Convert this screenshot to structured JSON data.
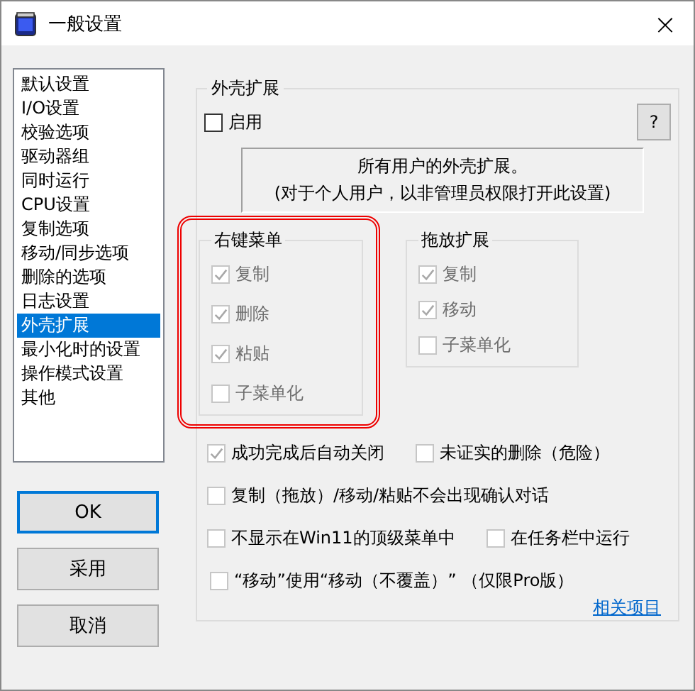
{
  "window": {
    "title": "一般设置",
    "close": "×"
  },
  "sidebar": {
    "items": [
      {
        "label": "默认设置",
        "selected": false
      },
      {
        "label": "I/O设置",
        "selected": false
      },
      {
        "label": "校验选项",
        "selected": false
      },
      {
        "label": "驱动器组",
        "selected": false
      },
      {
        "label": "同时运行",
        "selected": false
      },
      {
        "label": "CPU设置",
        "selected": false
      },
      {
        "label": "复制选项",
        "selected": false
      },
      {
        "label": "移动/同步选项",
        "selected": false
      },
      {
        "label": "删除的选项",
        "selected": false
      },
      {
        "label": "日志设置",
        "selected": false
      },
      {
        "label": "外壳扩展",
        "selected": true
      },
      {
        "label": "最小化时的设置",
        "selected": false
      },
      {
        "label": "操作模式设置",
        "selected": false
      },
      {
        "label": "其他",
        "selected": false
      }
    ]
  },
  "buttons": [
    {
      "label": "OK",
      "default": true
    },
    {
      "label": "采用",
      "default": false
    },
    {
      "label": "取消",
      "default": false
    }
  ],
  "shell_extension": {
    "title": "外壳扩展",
    "enable": {
      "label": "启用",
      "checked": false,
      "disabled": false
    },
    "help_button": "?",
    "info": [
      "所有用户的外壳扩展。",
      "(对于个人用户，以非管理员权限打开此设置)"
    ],
    "context_menu": {
      "title": "右键菜单",
      "highlighted": true,
      "disabled": true,
      "options": [
        {
          "label": "复制",
          "checked": true,
          "disabled": true
        },
        {
          "label": "删除",
          "checked": true,
          "disabled": true
        },
        {
          "label": "粘贴",
          "checked": true,
          "disabled": true
        },
        {
          "label": "子菜单化",
          "checked": false,
          "disabled": true
        }
      ]
    },
    "drag_drop": {
      "title": "拖放扩展",
      "highlighted": false,
      "disabled": true,
      "options": [
        {
          "label": "复制",
          "checked": true,
          "disabled": true
        },
        {
          "label": "移动",
          "checked": true,
          "disabled": true
        },
        {
          "label": "子菜单化",
          "checked": false,
          "disabled": true
        }
      ]
    },
    "options": [
      [
        {
          "label": "成功完成后自动关闭",
          "checked": true,
          "disabled": true
        },
        {
          "label": "未证实的删除（危险）",
          "checked": false,
          "disabled": true
        }
      ],
      [
        {
          "label": "复制（拖放）/移动/粘贴不会出现确认对话",
          "checked": false,
          "disabled": true
        }
      ],
      [
        {
          "label": "不显示在Win11的顶级菜单中",
          "checked": false,
          "disabled": true
        },
        {
          "label": "在任务栏中运行",
          "checked": false,
          "disabled": true
        }
      ],
      [
        {
          "label": "“移动”使用“移动（不覆盖）” （仅限Pro版）",
          "checked": false,
          "disabled": true
        }
      ]
    ],
    "related_link": "相关项目"
  }
}
